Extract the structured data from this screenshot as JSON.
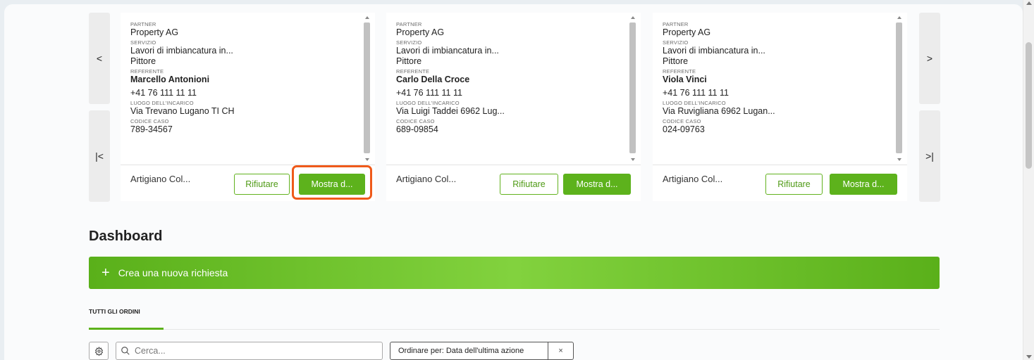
{
  "nav": {
    "prev": "<",
    "first": "|<",
    "next": ">",
    "last": ">|"
  },
  "cards": [
    {
      "partner_label": "PARTNER",
      "partner": "Property AG",
      "service_label": "SERVIZIO",
      "service": "Lavori di imbiancatura in...",
      "service_type": "Pittore",
      "contact_label": "REFERENTE",
      "contact": "Marcello Antonioni",
      "phone": "+41 76 111 11 11",
      "location_label": "LUOGO DELL'INCARICO",
      "location": "Via Trevano Lugano TI CH",
      "case_label": "CODICE CASO",
      "case": "789-34567",
      "footer": "Artigiano Col...",
      "reject": "Rifiutare",
      "show": "Mostra d..."
    },
    {
      "partner_label": "PARTNER",
      "partner": "Property AG",
      "service_label": "SERVIZIO",
      "service": "Lavori di imbiancatura in...",
      "service_type": "Pittore",
      "contact_label": "REFERENTE",
      "contact": "Carlo Della Croce",
      "phone": "+41 76 111 11 11",
      "location_label": "LUOGO DELL'INCARICO",
      "location": "Via Luigi Taddei 6962 Lug...",
      "case_label": "CODICE CASO",
      "case": "689-09854",
      "footer": "Artigiano Col...",
      "reject": "Rifiutare",
      "show": "Mostra d..."
    },
    {
      "partner_label": "PARTNER",
      "partner": "Property AG",
      "service_label": "SERVIZIO",
      "service": "Lavori di imbiancatura in...",
      "service_type": "Pittore",
      "contact_label": "REFERENTE",
      "contact": "Viola Vinci",
      "phone": "+41 76 111 11 11",
      "location_label": "LUOGO DELL'INCARICO",
      "location": "Via Ruvigliana 6962 Lugan...",
      "case_label": "CODICE CASO",
      "case": "024-09763",
      "footer": "Artigiano Col...",
      "reject": "Rifiutare",
      "show": "Mostra d..."
    }
  ],
  "dashboard": {
    "title": "Dashboard",
    "create_label": "Crea una nuova richiesta",
    "tab_all": "TUTTI GLI ORDINI",
    "search_placeholder": "Cerca...",
    "sort_label": "Ordinare per: Data dell'ultima azione",
    "clear": "×"
  },
  "colors": {
    "accent": "#5db21c",
    "highlight": "#ef5a1a"
  }
}
